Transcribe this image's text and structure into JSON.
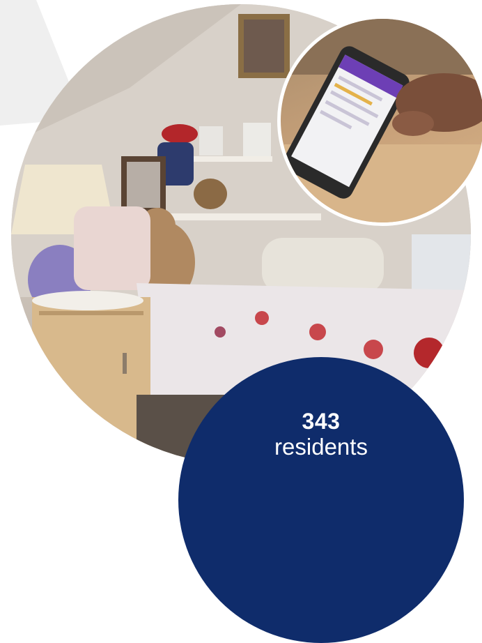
{
  "stat": {
    "number": "343",
    "label": "residents"
  },
  "colors": {
    "accent": "#0f2c6b",
    "background_shape": "#efefef"
  },
  "images": [
    {
      "name": "bedroom-photo"
    },
    {
      "name": "phone-app-photo"
    }
  ]
}
